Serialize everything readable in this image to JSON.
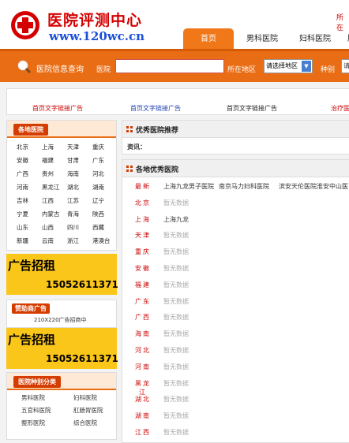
{
  "site": {
    "title": "医院评测中心",
    "url": "www.120wc.cn",
    "top_right": "所在"
  },
  "nav": {
    "tabs": [
      "首页",
      "男科医院",
      "妇科医院",
      "肛"
    ]
  },
  "search": {
    "title": "医院信息查询",
    "hospital_label": "医院",
    "hospital_value": "",
    "area_label": "所在地区",
    "area_selected": "请选择地区",
    "type_label": "种别",
    "type_selected": "请"
  },
  "ads": {
    "links": [
      "首页文字链接广告",
      "首页文字链接广告",
      "首页文字链接广告",
      "治疗医"
    ]
  },
  "sidebar": {
    "regions_title": "各地医院",
    "regions": [
      "北京",
      "上海",
      "天津",
      "重庆",
      "安徽",
      "福建",
      "甘肃",
      "广东",
      "广西",
      "贵州",
      "海南",
      "河北",
      "河南",
      "黑龙江",
      "湖北",
      "湖南",
      "吉林",
      "江西",
      "江苏",
      "辽宁",
      "宁夏",
      "内蒙古",
      "青海",
      "陕西",
      "山东",
      "山西",
      "四川",
      "西藏",
      "新疆",
      "云南",
      "浙江",
      "港澳台"
    ],
    "ad1_text": "广告招租",
    "ad1_phone": "15052611371",
    "sponsor_title": "赞助商广告",
    "sponsor_sub": "210X220广告招商中",
    "ad2_text": "广告招租",
    "ad2_phone": "15052611371",
    "category_title": "医院种别分类",
    "categories": [
      "男科医院",
      "妇科医院",
      "五官科医院",
      "肛肠胃医院",
      "整形医院",
      "综合医院"
    ]
  },
  "main": {
    "recommend_title": "优秀医院推荐",
    "recommend_label": "资讯：",
    "regions_title": "各地优秀医院",
    "rows": [
      {
        "name": "最新",
        "values": [
          "上海九龙男子医院",
          "南京马力妇科医院",
          "滨安天伦医院",
          "淮安中山医"
        ]
      },
      {
        "name": "北京",
        "values": [
          "暂无数据"
        ]
      },
      {
        "name": "上海",
        "values": [
          "上海九龙"
        ]
      },
      {
        "name": "天津",
        "values": [
          "暂无数据"
        ]
      },
      {
        "name": "重庆",
        "values": [
          "暂无数据"
        ]
      },
      {
        "name": "安徽",
        "values": [
          "暂无数据"
        ]
      },
      {
        "name": "福建",
        "values": [
          "暂无数据"
        ]
      },
      {
        "name": "广东",
        "values": [
          "暂无数据"
        ]
      },
      {
        "name": "广西",
        "values": [
          "暂无数据"
        ]
      },
      {
        "name": "海南",
        "values": [
          "暂无数据"
        ]
      },
      {
        "name": "河北",
        "values": [
          "暂无数据"
        ]
      },
      {
        "name": "河南",
        "values": [
          "暂无数据"
        ]
      },
      {
        "name": "黑龙江",
        "values": [
          "暂无数据"
        ]
      },
      {
        "name": "湖北",
        "values": [
          "暂无数据"
        ]
      },
      {
        "name": "湖南",
        "values": [
          "暂无数据"
        ]
      },
      {
        "name": "江西",
        "values": [
          "暂无数据"
        ]
      }
    ]
  },
  "colors": {
    "accent": "#e96d15",
    "brand_red": "#d40000",
    "ad_yellow": "#fbc61a"
  }
}
